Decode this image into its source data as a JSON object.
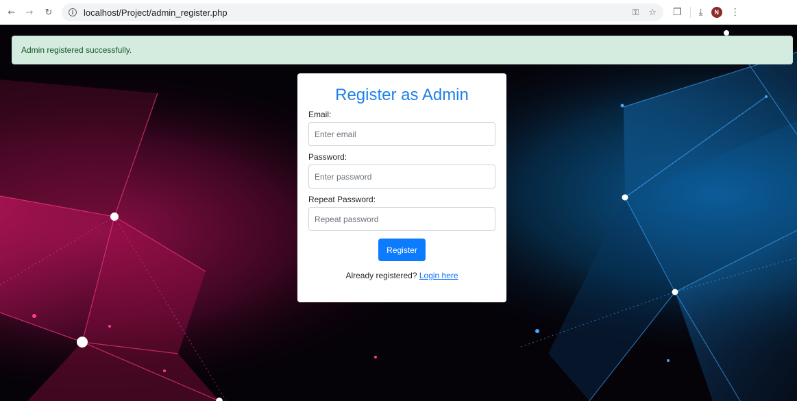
{
  "browser": {
    "url": "localhost/Project/admin_register.php",
    "icons": [
      "back-arrow-icon",
      "forward-arrow-icon",
      "reload-icon",
      "site-info-icon",
      "password-key-icon",
      "bookmark-star-icon",
      "extensions-icon",
      "download-icon",
      "profile-avatar-icon",
      "menu-icon"
    ],
    "avatar_initial": "N"
  },
  "alert": {
    "message": "Admin registered successfully.",
    "color": "#d4ebe0"
  },
  "form": {
    "title": "Register as Admin",
    "email_label": "Email:",
    "email_placeholder": "Enter email",
    "password_label": "Password:",
    "password_placeholder": "Enter password",
    "repeat_label": "Repeat Password:",
    "repeat_placeholder": "Repeat password",
    "submit_label": "Register",
    "login_prompt": "Already registered?",
    "login_link": "Login here"
  },
  "colors": {
    "accent": "#1e80e8",
    "button": "#0d7bfe",
    "left_glow": "#e0196b",
    "right_glow": "#1a7fd0"
  }
}
